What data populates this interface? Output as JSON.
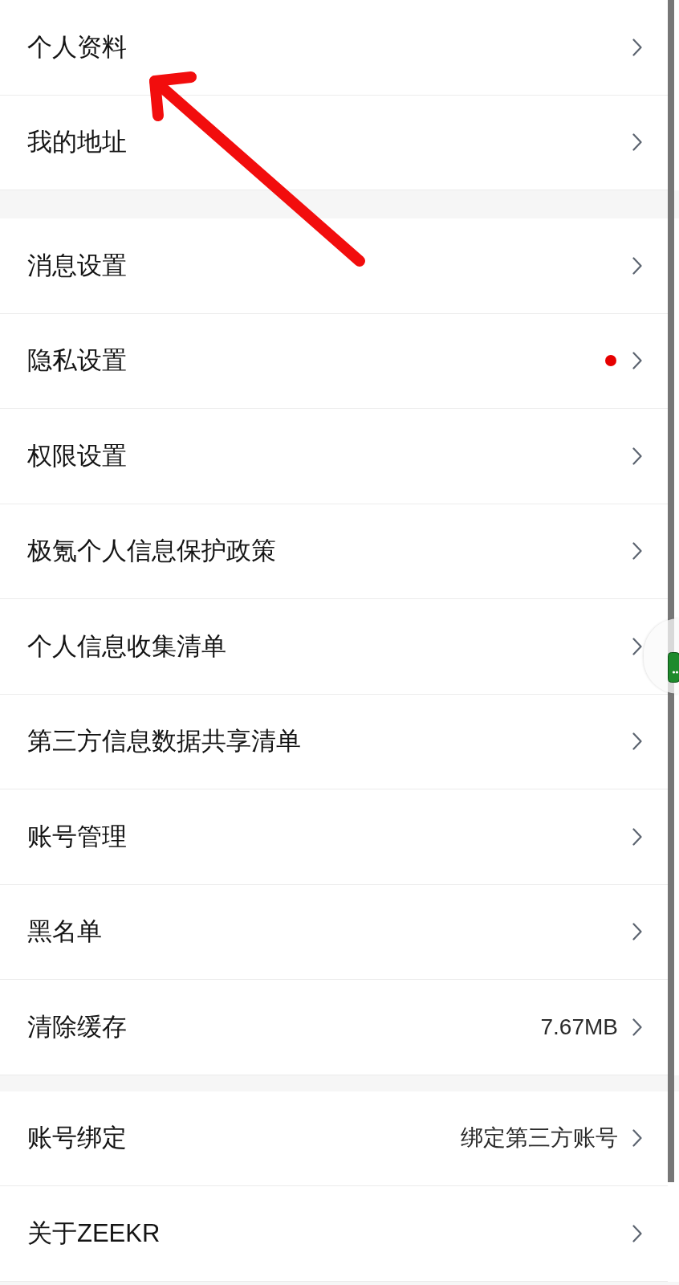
{
  "groups": [
    {
      "items": [
        {
          "label": "个人资料",
          "new_badge": false
        },
        {
          "label": "我的地址",
          "new_badge": false
        }
      ]
    },
    {
      "items": [
        {
          "label": "消息设置",
          "new_badge": false
        },
        {
          "label": "隐私设置",
          "new_badge": true
        },
        {
          "label": "权限设置",
          "new_badge": false
        },
        {
          "label": "极氪个人信息保护政策",
          "new_badge": false
        },
        {
          "label": "个人信息收集清单",
          "new_badge": false
        },
        {
          "label": "第三方信息数据共享清单",
          "new_badge": false
        },
        {
          "label": "账号管理",
          "new_badge": false
        },
        {
          "label": "黑名单",
          "new_badge": false
        },
        {
          "label": "清除缓存",
          "value": "7.67MB",
          "new_badge": false
        }
      ]
    },
    {
      "items": [
        {
          "label": "账号绑定",
          "value": "绑定第三方账号",
          "new_badge": false
        },
        {
          "label": "关于ZEEKR",
          "new_badge": false
        }
      ]
    }
  ]
}
